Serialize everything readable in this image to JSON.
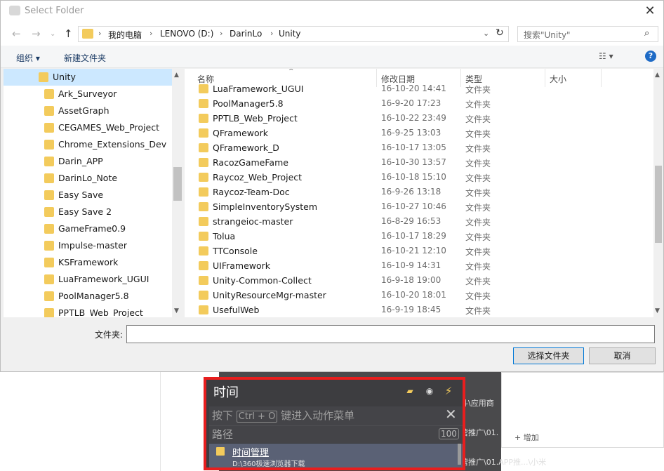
{
  "dialog": {
    "title": "Select Folder",
    "close": "✕"
  },
  "address": {
    "crumbs": [
      "我的电脑",
      "LENOVO (D:)",
      "DarinLo",
      "Unity"
    ],
    "search_placeholder": "搜索\"Unity\""
  },
  "toolbar": {
    "organize": "组织 ▾",
    "new_folder": "新建文件夹"
  },
  "nav_tree": {
    "selected": "Unity",
    "items": [
      "Ark_Surveyor",
      "AssetGraph",
      "CEGAMES_Web_Project",
      "Chrome_Extensions_Dev",
      "Darin_APP",
      "DarinLo_Note",
      "Easy Save",
      "Easy Save 2",
      "GameFrame0.9",
      "Impulse-master",
      "KSFramework",
      "LuaFramework_UGUI",
      "PoolManager5.8",
      "PPTLB_Web_Project"
    ]
  },
  "file_list": {
    "columns": {
      "name": "名称",
      "modified": "修改日期",
      "type": "类型",
      "size": "大小"
    },
    "rows": [
      {
        "name": "LuaFramework_UGUI",
        "date": "16-10-20 14:41",
        "type": "文件夹"
      },
      {
        "name": "PoolManager5.8",
        "date": "16-9-20 17:23",
        "type": "文件夹"
      },
      {
        "name": "PPTLB_Web_Project",
        "date": "16-10-22 23:49",
        "type": "文件夹"
      },
      {
        "name": "QFramework",
        "date": "16-9-25 13:03",
        "type": "文件夹"
      },
      {
        "name": "QFramework_D",
        "date": "16-10-17 13:05",
        "type": "文件夹"
      },
      {
        "name": "RacozGameFame",
        "date": "16-10-30 13:57",
        "type": "文件夹"
      },
      {
        "name": "Raycoz_Web_Project",
        "date": "16-10-18 15:10",
        "type": "文件夹"
      },
      {
        "name": "Raycoz-Team-Doc",
        "date": "16-9-26 13:18",
        "type": "文件夹"
      },
      {
        "name": "SimpleInventorySystem",
        "date": "16-10-27 10:46",
        "type": "文件夹"
      },
      {
        "name": "strangeioc-master",
        "date": "16-8-29 16:53",
        "type": "文件夹"
      },
      {
        "name": "Tolua",
        "date": "16-10-17 18:29",
        "type": "文件夹"
      },
      {
        "name": "TTConsole",
        "date": "16-10-21 12:10",
        "type": "文件夹"
      },
      {
        "name": "UIFramework",
        "date": "16-10-9 14:31",
        "type": "文件夹"
      },
      {
        "name": "Unity-Common-Collect",
        "date": "16-9-18 19:00",
        "type": "文件夹"
      },
      {
        "name": "UnityResourceMgr-master",
        "date": "16-10-20 18:01",
        "type": "文件夹"
      },
      {
        "name": "UsefulWeb",
        "date": "16-9-19 18:45",
        "type": "文件夹"
      }
    ]
  },
  "footer": {
    "folder_label": "文件夹:",
    "folder_value": "",
    "select_button": "选择文件夹",
    "cancel_button": "取消"
  },
  "background": {
    "line1": "斗\\应用商",
    "line2": "营推广\\01.",
    "line3": "营推广\\01.APP推...\\小米",
    "add": "+ 增加"
  },
  "launcher": {
    "title": "时间",
    "hint_prefix": "按下",
    "hint_key": "Ctrl + O",
    "hint_suffix": "键进入动作菜单",
    "path_label": "路径",
    "count": "100",
    "result_title": "时间管理",
    "result_path": "D:\\360极速浏览器下载"
  }
}
